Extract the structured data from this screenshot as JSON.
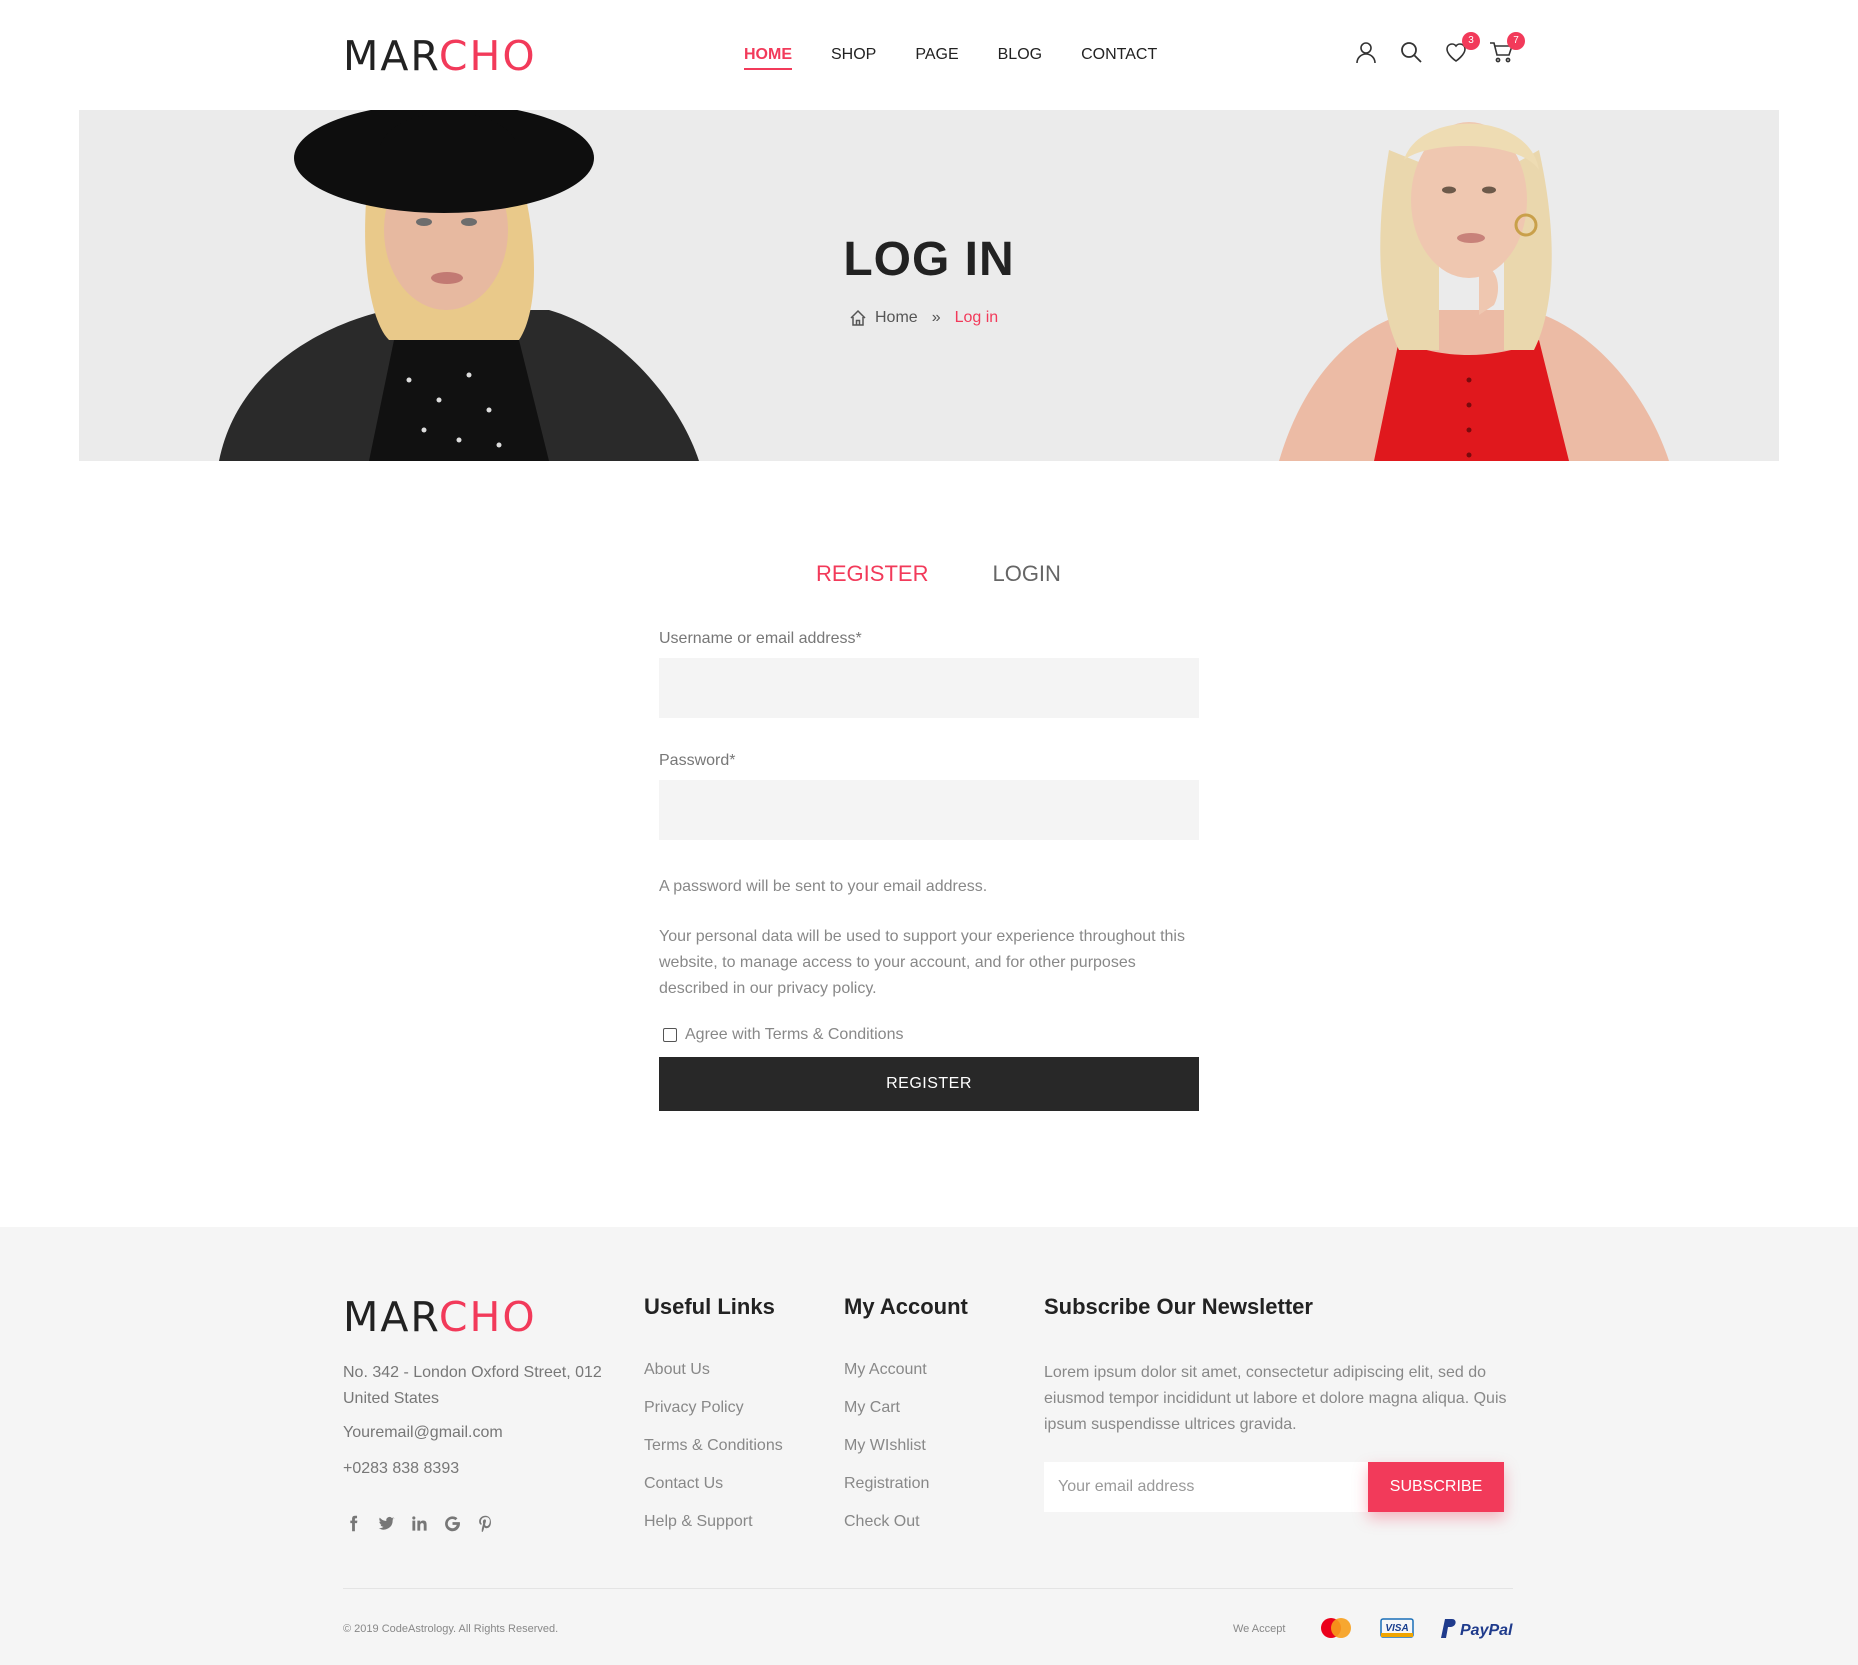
{
  "brand": {
    "logo_part1": "MAR",
    "logo_part2": "CHO"
  },
  "nav": [
    "HOME",
    "SHOP",
    "PAGE",
    "BLOG",
    "CONTACT"
  ],
  "header_icons": {
    "user": "user-icon",
    "search": "search-icon",
    "wishlist": "heart-icon",
    "wishlist_count": "3",
    "cart": "cart-icon",
    "cart_count": "7"
  },
  "hero": {
    "title": "LOG IN",
    "breadcrumb_home": "Home",
    "breadcrumb_current": "Log in"
  },
  "tabs": [
    "REGISTER",
    "LOGIN"
  ],
  "form": {
    "username_label": "Username or email address*",
    "password_label": "Password*",
    "note1": "A password will be sent to your email address.",
    "note2": "Your personal data will be used to support your experience throughout this website, to manage access to your account, and for other purposes described in our privacy policy.",
    "agree_label": "Agree with Terms & Conditions",
    "submit_label": "REGISTER"
  },
  "footer": {
    "address": "No. 342 - London Oxford Street, 012 United States",
    "email": "Youremail@gmail.com",
    "phone": "+0283 838 8393",
    "social": [
      "facebook-icon",
      "twitter-icon",
      "linkedin-icon",
      "google-icon",
      "pinterest-icon"
    ],
    "useful_links_title": "Useful Links",
    "useful_links": [
      "About Us",
      "Privacy Policy",
      "Terms & Conditions",
      "Contact Us",
      "Help & Support"
    ],
    "account_title": "My Account",
    "account_links": [
      "My Account",
      "My Cart",
      "My WIshlist",
      "Registration",
      "Check Out"
    ],
    "newsletter_title": "Subscribe Our Newsletter",
    "newsletter_text": "Lorem ipsum dolor sit amet, consectetur adipiscing elit, sed do eiusmod tempor incididunt ut labore et dolore magna aliqua. Quis ipsum suspendisse ultrices gravida.",
    "newsletter_placeholder": "Your email address",
    "subscribe_label": "SUBSCRIBE",
    "copyright": "© 2019 CodeAstrology. All Rights Reserved.",
    "we_accept": "We Accept",
    "payments": [
      "mastercard-icon",
      "visa-icon",
      "paypal-icon"
    ],
    "paypal_text": "PayPal",
    "visa_text": "VISA"
  },
  "colors": {
    "accent": "#f23a5a",
    "dark": "#282828",
    "hero_bg": "#ebebeb",
    "footer_bg": "#f5f5f5"
  }
}
